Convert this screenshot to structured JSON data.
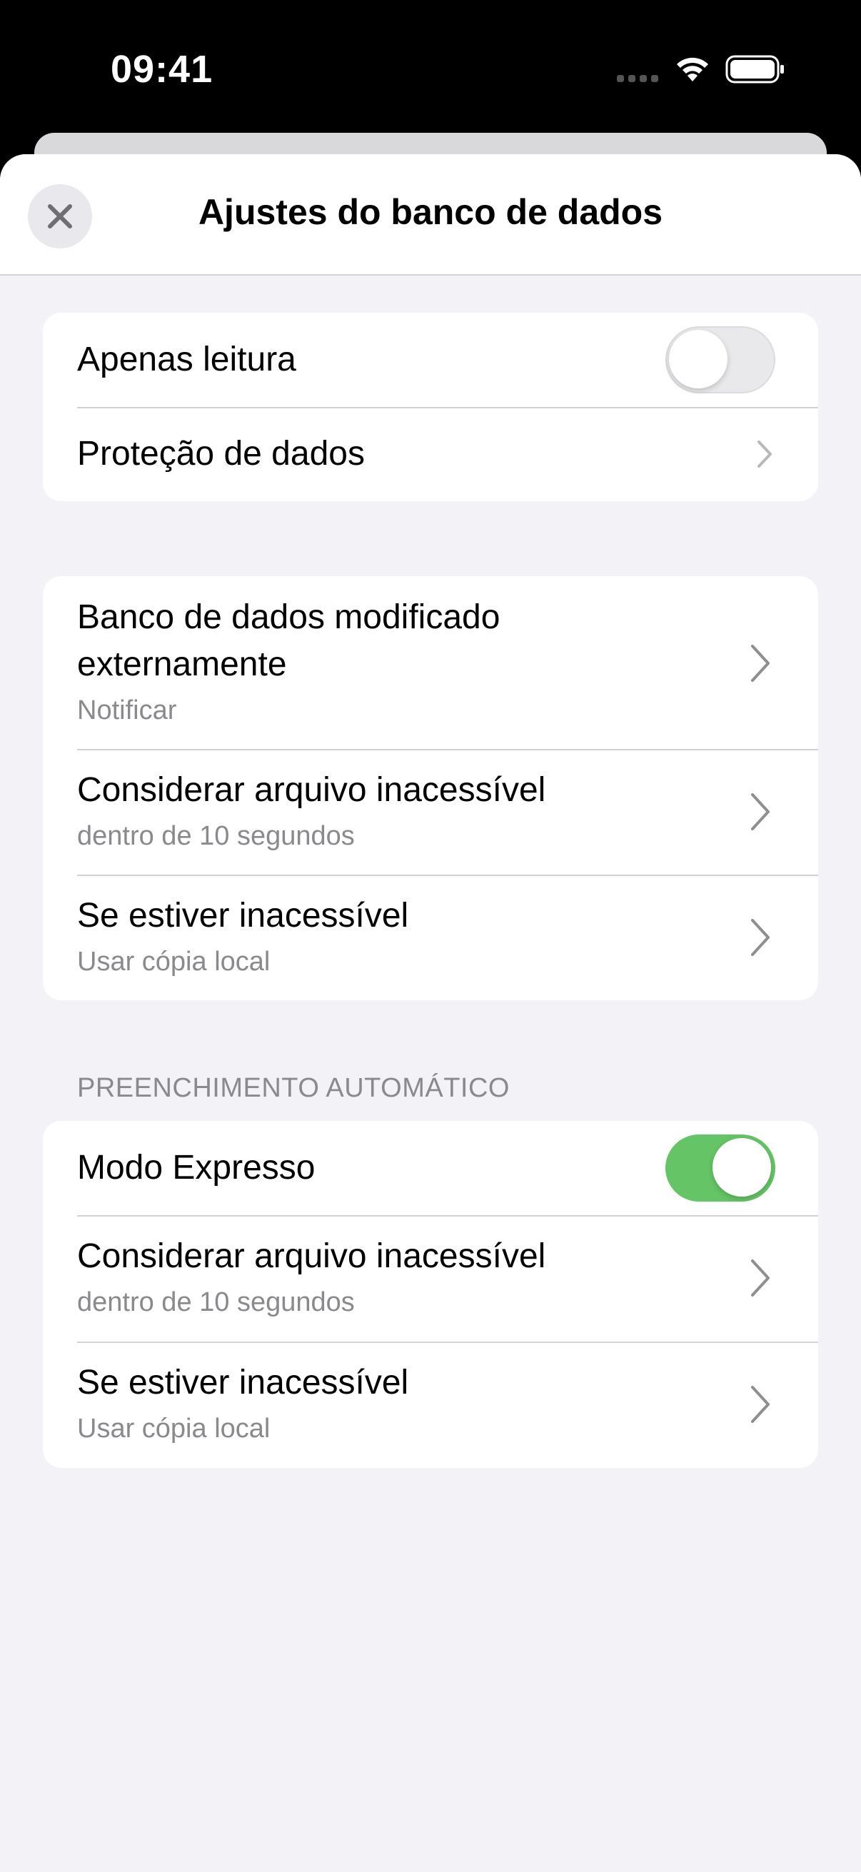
{
  "status_bar": {
    "time": "09:41"
  },
  "nav": {
    "title": "Ajustes do banco de dados",
    "close_icon": "close-icon"
  },
  "group1": {
    "read_only": {
      "label": "Apenas leitura",
      "toggle_on": false
    },
    "data_protection": {
      "label": "Proteção de dados"
    }
  },
  "group2": {
    "items": [
      {
        "title_line1": "Banco de dados modificado",
        "title_line2": "externamente",
        "subtitle": "Notificar"
      },
      {
        "title": "Considerar arquivo inacessível",
        "subtitle": "dentro de 10 segundos"
      },
      {
        "title": "Se estiver inacessível",
        "subtitle": "Usar cópia local"
      }
    ]
  },
  "group3": {
    "header": "PREENCHIMENTO AUTOMÁTICO",
    "express_mode": {
      "label": "Modo Expresso",
      "toggle_on": true
    },
    "items": [
      {
        "title": "Considerar arquivo inacessível",
        "subtitle": "dentro de 10 segundos"
      },
      {
        "title": "Se estiver inacessível",
        "subtitle": "Usar cópia local"
      }
    ]
  },
  "colors": {
    "toggle_on": "#65c466",
    "toggle_off": "#e9e9eb",
    "background": "#f2f2f7",
    "secondary_text": "#8a8a8e"
  }
}
